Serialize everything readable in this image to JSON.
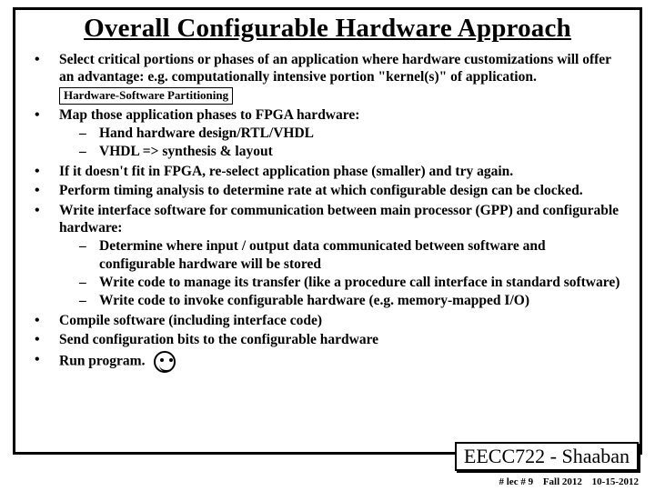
{
  "title": "Overall Configurable Hardware Approach",
  "bullets": {
    "b1a": "Select critical portions or phases of an application where hardware customizations will offer an advantage: e.g. computationally intensive portion \"kernel(s)\" of application.",
    "inlineBox": "Hardware-Software Partitioning",
    "b2": "Map those application phases to FPGA hardware:",
    "b2s1": "Hand hardware design/RTL/VHDL",
    "b2s2": "VHDL => synthesis & layout",
    "b3": "If it doesn't fit in FPGA, re-select application phase (smaller) and try again.",
    "b4": "Perform timing analysis to determine rate at which configurable design can be clocked.",
    "b5": "Write interface software for communication between main processor (GPP) and configurable hardware:",
    "b5s1": "Determine where input / output data communicated between software and configurable hardware will be stored",
    "b5s2": "Write code to manage its transfer (like a procedure call interface in standard software)",
    "b5s3": "Write code to invoke configurable hardware (e.g. memory-mapped I/O)",
    "b6": "Compile software (including interface code)",
    "b7": "Send configuration bits to the configurable hardware",
    "b8": "Run program."
  },
  "footer": {
    "course": "EECC722 - Shaaban",
    "lec": "#  lec # 9",
    "term": "Fall 2012",
    "date": "10-15-2012"
  }
}
